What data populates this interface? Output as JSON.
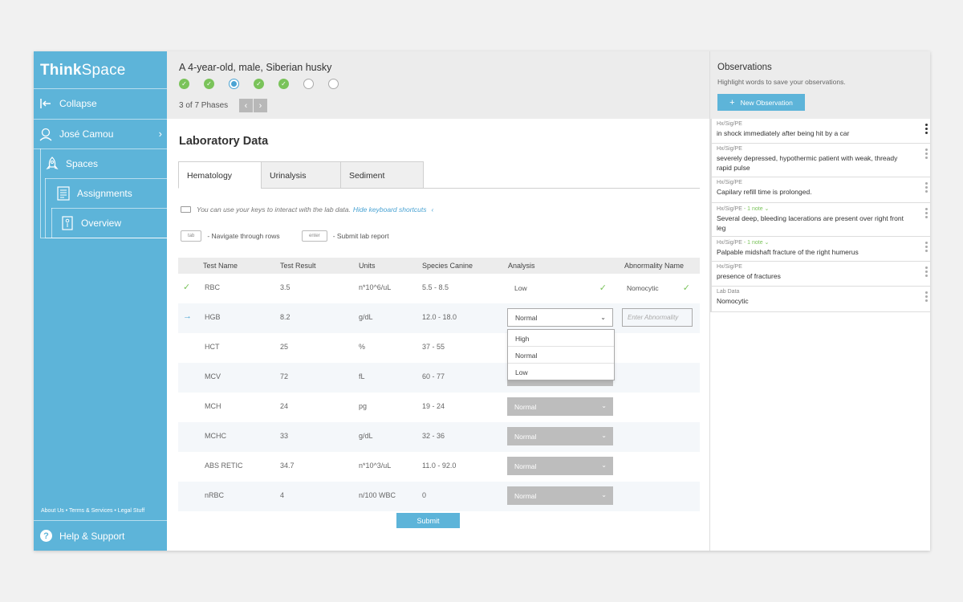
{
  "sidebar": {
    "brand_bold": "Think",
    "brand_light": "Space",
    "collapse": "Collapse",
    "user": "José Camou",
    "spaces": "Spaces",
    "assignments": "Assignments",
    "overview": "Overview",
    "footer": "About Us  •  Terms & Services  •  Legal Stuff",
    "help": "Help & Support"
  },
  "header": {
    "case_title": "A 4-year-old, male, Siberian husky",
    "phases": [
      "done",
      "done",
      "current",
      "done",
      "done",
      "todo",
      "todo"
    ],
    "phase_count": "3 of  7  Phases",
    "prev": "‹",
    "next": "›"
  },
  "main": {
    "title": "Laboratory Data",
    "tabs": [
      "Hematology",
      "Urinalysis",
      "Sediment"
    ],
    "kb_note": "You can use your keys to interact with the lab data.",
    "kb_link": "Hide keyboard shortcuts",
    "kb_link_chev": "‹",
    "shortcut_tab_key": "tab",
    "shortcut_tab_text": "- Navigate through rows",
    "shortcut_enter_key": "enter",
    "shortcut_enter_text": "- Submit lab report",
    "columns": [
      "Test Name",
      "Test Result",
      "Units",
      "Species Canine",
      "Analysis",
      "Abnormality Name"
    ],
    "rows": [
      {
        "name": "RBC",
        "result": "3.5",
        "units": "n*10^6/uL",
        "range": "5.5 - 8.5",
        "analysis": "Low",
        "abnormality": "Nomocytic"
      },
      {
        "name": "HGB",
        "result": "8.2",
        "units": "g/dL",
        "range": "12.0 - 18.0",
        "analysis": "Normal",
        "abnormality_placeholder": "Enter Abnormality"
      },
      {
        "name": "HCT",
        "result": "25",
        "units": "%",
        "range": "37 - 55"
      },
      {
        "name": "MCV",
        "result": "72",
        "units": "fL",
        "range": "60 - 77"
      },
      {
        "name": "MCH",
        "result": "24",
        "units": "pg",
        "range": "19 - 24",
        "analysis": "Normal"
      },
      {
        "name": "MCHC",
        "result": "33",
        "units": "g/dL",
        "range": "32 - 36",
        "analysis": "Normal"
      },
      {
        "name": "ABS RETIC",
        "result": "34.7",
        "units": "n*10^3/uL",
        "range": "11.0 - 92.0",
        "analysis": "Normal"
      },
      {
        "name": "nRBC",
        "result": "4",
        "units": "n/100 WBC",
        "range": "0",
        "analysis": "Normal"
      }
    ],
    "dropdown_options": [
      "High",
      "Normal",
      "Low"
    ],
    "submit": "Submit"
  },
  "observations": {
    "title": "Observations",
    "subtitle": "Highlight words to save your observations.",
    "new_button": "New Observation",
    "items": [
      {
        "category": "Hx/Sig/PE",
        "note": "",
        "text": "in shock immediately after being hit by a car"
      },
      {
        "category": "Hx/Sig/PE",
        "note": "",
        "text": "severely depressed, hypothermic patient with weak, thready rapid pulse"
      },
      {
        "category": "Hx/Sig/PE",
        "note": "",
        "text": "Capilary refill time is prolonged."
      },
      {
        "category": "Hx/Sig/PE",
        "note": " - 1 note ⌄",
        "text": "Several deep, bleeding lacerations are present over right front leg"
      },
      {
        "category": "Hx/Sig/PE",
        "note": " - 1 note ⌄",
        "text": "Palpable midshaft fracture of the right humerus"
      },
      {
        "category": "Hx/Sig/PE",
        "note": "",
        "text": "presence of fractures"
      },
      {
        "category": "Lab Data",
        "note": "",
        "text": "Nomocytic"
      }
    ]
  },
  "colors": {
    "accent": "#5db4d9",
    "success": "#7ac35a",
    "link": "#4aa3d3"
  }
}
